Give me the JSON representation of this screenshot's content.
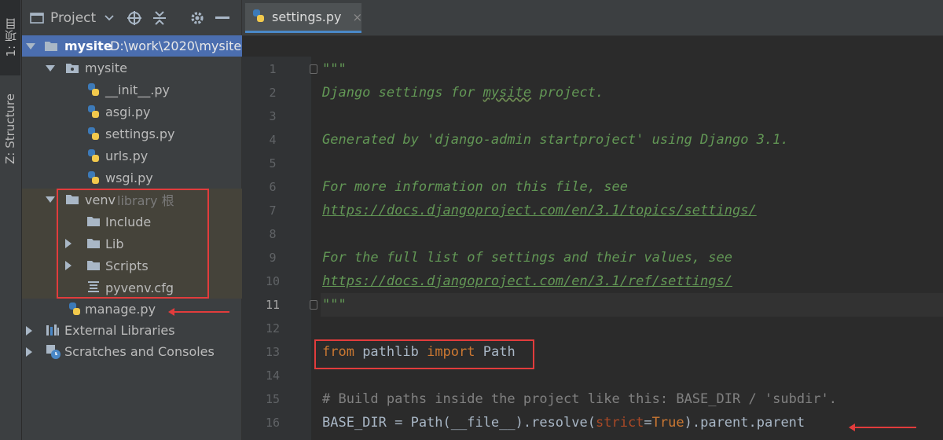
{
  "toolstrip": {
    "project_tab": "1: 项目",
    "structure_tab": "Z: Structure"
  },
  "panel": {
    "title": "Project",
    "icons": [
      "chevron-down-icon",
      "locate-icon",
      "collapse-icon",
      "gear-icon",
      "minimize-icon"
    ]
  },
  "tree": {
    "root_name": "mysite",
    "root_path": "D:\\work\\2020\\mysite",
    "mysite_folder": "mysite",
    "files": [
      "__init__.py",
      "asgi.py",
      "settings.py",
      "urls.py",
      "wsgi.py"
    ],
    "venv": "venv",
    "venv_note": "library 根",
    "venv_children": [
      "Include",
      "Lib",
      "Scripts",
      "pyvenv.cfg"
    ],
    "manage": "manage.py",
    "external": "External Libraries",
    "scratches": "Scratches and Consoles"
  },
  "editor": {
    "tab_label": "settings.py",
    "tab_close": "×",
    "current_line": 11,
    "line_numbers": [
      "1",
      "2",
      "3",
      "4",
      "5",
      "6",
      "7",
      "8",
      "9",
      "10",
      "11",
      "12",
      "13",
      "14",
      "15",
      "16"
    ],
    "lines": {
      "l1": "\"\"\"",
      "l2a": "Django settings for ",
      "l2b": "mysite",
      "l2c": " project.",
      "l4": "Generated by 'django-admin startproject' using Django 3.1.",
      "l6": "For more information on this file, see",
      "l7": "https://docs.djangoproject.com/en/3.1/topics/settings/",
      "l9": "For the full list of settings and their values, see",
      "l10": "https://docs.djangoproject.com/en/3.1/ref/settings/",
      "l11": "\"\"\"",
      "l13_from": "from",
      "l13_mod": " pathlib ",
      "l13_import": "import",
      "l13_name": " Path",
      "l15": "# Build paths inside the project like this: BASE_DIR / 'subdir'.",
      "l16a": "BASE_DIR = Path(__file__).resolve(",
      "l16b": "strict",
      "l16c": "=",
      "l16d": "True",
      "l16e": ").parent.parent"
    }
  },
  "colors": {
    "accent_selection": "#4b6eaf",
    "annotation_red": "#e23c3c",
    "docstring_green": "#629755",
    "keyword_orange": "#cc7832"
  }
}
